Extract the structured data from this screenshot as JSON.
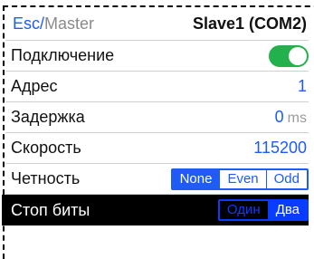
{
  "header": {
    "esc_label": "Esc",
    "separator": "/",
    "master_label": "Master",
    "device": "Slave1 (COM2)"
  },
  "rows": {
    "connection": {
      "label": "Подключение",
      "enabled": true
    },
    "address": {
      "label": "Адрес",
      "value": "1"
    },
    "delay": {
      "label": "Задержка",
      "value": "0",
      "unit": "ms"
    },
    "speed": {
      "label": "Скорость",
      "value": "115200"
    },
    "parity": {
      "label": "Четность",
      "options": [
        "None",
        "Even",
        "Odd"
      ],
      "selected": "None"
    },
    "stop_bits": {
      "label": "Стоп биты",
      "options": [
        "Один",
        "Два"
      ],
      "selected": "Два"
    }
  },
  "colors": {
    "accent": "#1e5cf5",
    "toggle_on": "#22b14c"
  }
}
